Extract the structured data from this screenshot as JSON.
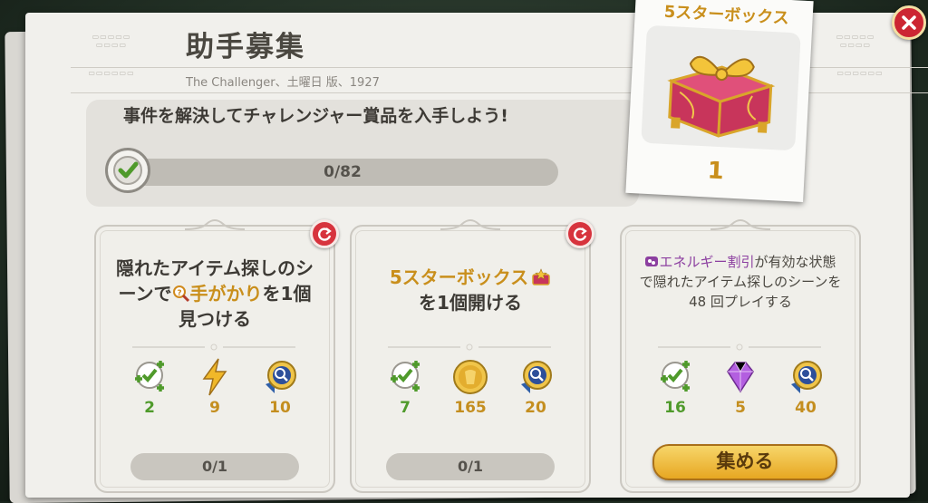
{
  "header": {
    "title": "助手募集",
    "subtitle": "The Challenger、土曜日 版、1927"
  },
  "main_task": {
    "text": "事件を解決してチャレンジャー賞品を入手しよう!",
    "progress_text": "0/82",
    "progress_fraction": 0
  },
  "prize": {
    "title": "5スターボックス",
    "count": "1",
    "icon": "gift-box-icon"
  },
  "cards": [
    {
      "text_parts": [
        "隠れたアイテム探しのシーンで",
        "手がかり",
        "を1個見つける"
      ],
      "rewards": [
        {
          "icon": "check-plus-icon",
          "value": "2"
        },
        {
          "icon": "energy-bolt-icon",
          "value": "9"
        },
        {
          "icon": "magnifier-medal-icon",
          "value": "10"
        }
      ],
      "progress_text": "0/1"
    },
    {
      "text_parts": [
        "5スターボックス",
        "を1個開ける"
      ],
      "rewards": [
        {
          "icon": "check-plus-icon",
          "value": "7"
        },
        {
          "icon": "gold-coin-icon",
          "value": "165"
        },
        {
          "icon": "magnifier-medal-icon",
          "value": "20"
        }
      ],
      "progress_text": "0/1"
    },
    {
      "text_parts": [
        "エネルギー割引",
        "が有効な状態で隠れたアイテム探しのシーンを 48 回プレイする"
      ],
      "rewards": [
        {
          "icon": "check-plus-icon",
          "value": "16"
        },
        {
          "icon": "purple-gem-icon",
          "value": "5"
        },
        {
          "icon": "magnifier-medal-icon",
          "value": "40"
        }
      ],
      "button_label": "集める"
    }
  ],
  "colors": {
    "accent_gold": "#c98f1c",
    "close_red": "#cc2633",
    "reward_green": "#4f9a2b"
  }
}
